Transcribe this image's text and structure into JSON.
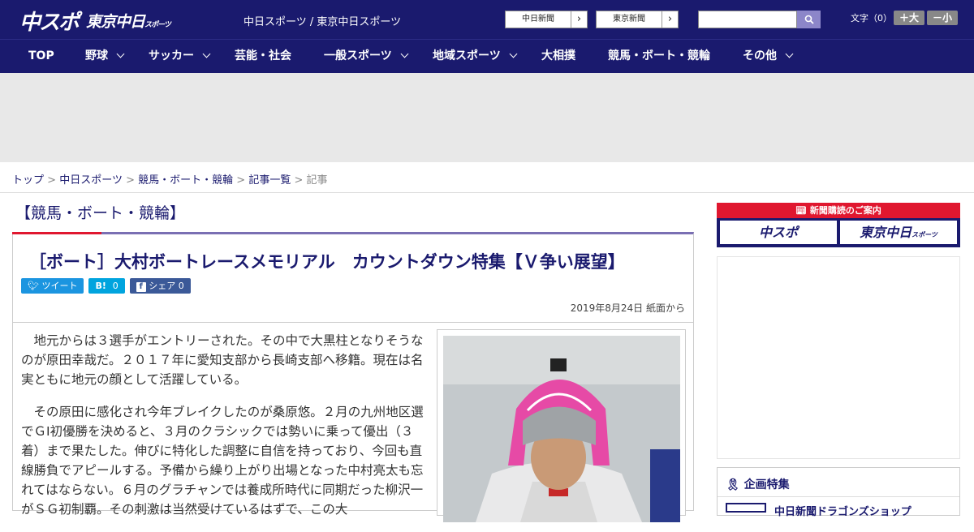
{
  "header": {
    "logo_main": "中スポ",
    "logo_sub": "東京中日",
    "logo_sub_small": "スポーツ",
    "site_names": "中日スポーツ / 東京中日スポーツ",
    "paper_buttons": [
      "中日新聞",
      "東京新聞"
    ],
    "font_size_label": "文字（0）",
    "font_larger": "＋大",
    "font_smaller": "－小",
    "brand_color": "#1a1a6e"
  },
  "nav": {
    "items": [
      {
        "label": "TOP",
        "dropdown": false
      },
      {
        "label": "野球",
        "dropdown": true
      },
      {
        "label": "サッカー",
        "dropdown": true
      },
      {
        "label": "芸能・社会",
        "dropdown": false
      },
      {
        "label": "一般スポーツ",
        "dropdown": true
      },
      {
        "label": "地域スポーツ",
        "dropdown": true
      },
      {
        "label": "大相撲",
        "dropdown": false
      },
      {
        "label": "競馬・ボート・競輪",
        "dropdown": false
      },
      {
        "label": "その他",
        "dropdown": true
      }
    ]
  },
  "breadcrumb": {
    "items": [
      "トップ",
      "中日スポーツ",
      "競馬・ボート・競輪",
      "記事一覧"
    ],
    "current": "記事",
    "sep": ">"
  },
  "article": {
    "category": "【競馬・ボート・競輪】",
    "headline": "［ボート］大村ボートレースメモリアル　カウントダウン特集【Ｖ争い展望】",
    "shares": {
      "tweet": "ツイート",
      "hatena": "B!",
      "hatena_count": "0",
      "facebook": "シェア",
      "facebook_count": "0"
    },
    "date": "2019年8月24日 紙面から",
    "paragraphs": [
      "地元からは３選手がエントリーされた。その中で大黒柱となりそうなのが原田幸哉だ。２０１７年に愛知支部から長崎支部へ移籍。現在は名実ともに地元の顔として活躍している。",
      "その原田に感化され今年ブレイクしたのが桑原悠。２月の九州地区選でＧⅠ初優勝を決めると、３月のクラシックでは勢いに乗って優出（３着）まで果たした。伸びに特化した調整に自信を持っており、今回も直線勝負でアピールする。予備から繰り上がり出場となった中村亮太も忘れてはならない。６月のグラチャンでは養成所時代に同期だった柳沢一がＳＧ初制覇。その刺激は当然受けているはずで、この大"
    ]
  },
  "sidebar": {
    "subscription_title": "新聞購読のご案内",
    "subscription_logos": [
      "中スポ",
      "東京中日"
    ],
    "subscription_logo_small": "スポーツ",
    "kikaku_title": "企画特集",
    "kikaku_item": "中日新聞ドラゴンズショップ"
  }
}
